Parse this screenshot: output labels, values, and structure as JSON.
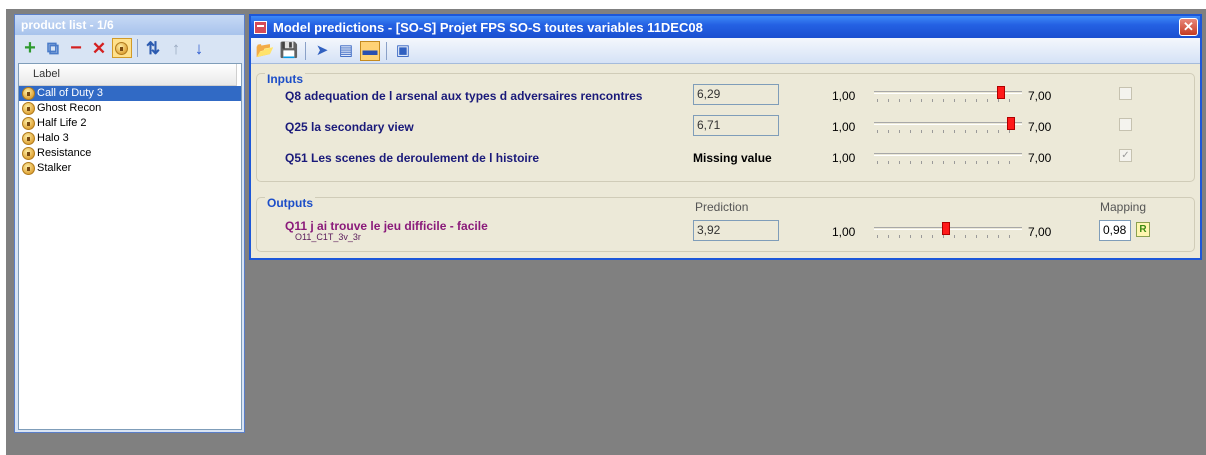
{
  "product_panel": {
    "title": "product list - 1/6",
    "toolbar": {
      "add": "+",
      "copy": "⧉",
      "remove": "−",
      "delete": "✕",
      "sort": "⇅",
      "up": "↑",
      "down": "↓"
    },
    "column_header": "Label",
    "items": [
      {
        "label": "Call of Duty 3"
      },
      {
        "label": "Ghost Recon"
      },
      {
        "label": "Half Life 2"
      },
      {
        "label": "Halo 3"
      },
      {
        "label": "Resistance"
      },
      {
        "label": "Stalker"
      }
    ],
    "selected_index": 0
  },
  "main_window": {
    "title": "Model predictions - [SO-S] Projet FPS SO-S toutes variables 11DEC08",
    "close_label": "✕",
    "toolbar_icons": [
      "open-folder-icon",
      "save-icon",
      "run-icon",
      "document-icon",
      "toggle-bar-icon",
      "export-icon"
    ],
    "inputs": {
      "title": "Inputs",
      "rows": [
        {
          "label": "Q8 adequation de l arsenal aux types d adversaires rencontres",
          "value": "6,29",
          "min": "1,00",
          "max": "7,00",
          "slider_value": 6.29,
          "checked": false,
          "missing": false
        },
        {
          "label": "Q25 la secondary view",
          "value": "6,71",
          "min": "1,00",
          "max": "7,00",
          "slider_value": 6.71,
          "checked": false,
          "missing": false
        },
        {
          "label": "Q51 Les scenes de deroulement de l histoire",
          "value": "Missing value",
          "min": "1,00",
          "max": "7,00",
          "slider_value": null,
          "checked": true,
          "missing": true
        }
      ]
    },
    "outputs": {
      "title": "Outputs",
      "prediction_header": "Prediction",
      "mapping_header": "Mapping",
      "rows": [
        {
          "label": "Q11 j ai trouve le jeu difficile - facile",
          "code": "O11_C1T_3v_3r",
          "value": "3,92",
          "min": "1,00",
          "max": "7,00",
          "slider_value": 3.92,
          "mapping": "0,98",
          "mapping_icon": "R"
        }
      ]
    }
  },
  "colors": {
    "title_bar": "#2461e3",
    "slider_thumb": "#ff1a1a",
    "input_label": "#1a1a7a",
    "output_label": "#8a1a7a"
  }
}
